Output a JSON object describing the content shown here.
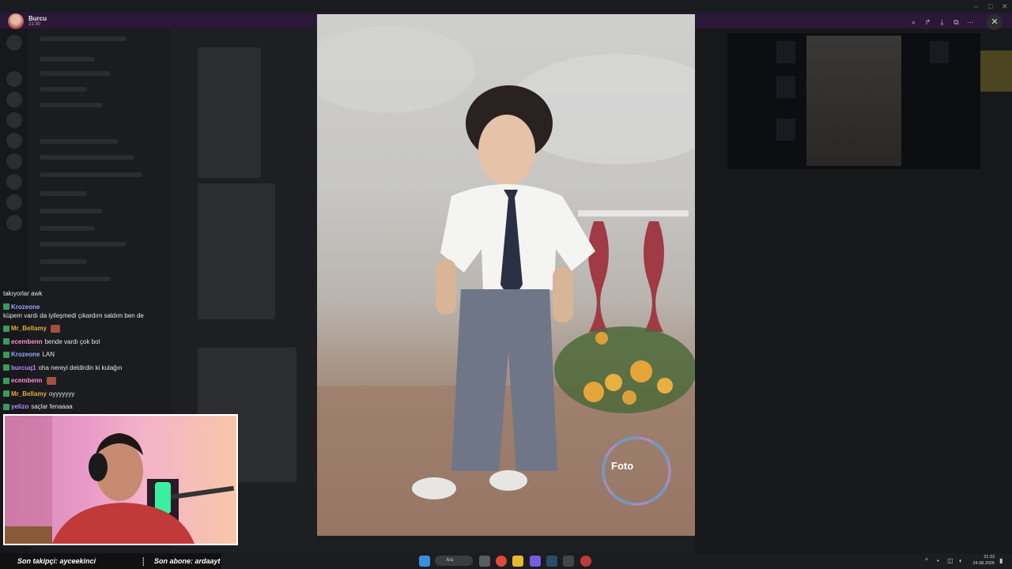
{
  "viewer": {
    "user_name": "Burcu",
    "time": "21:30",
    "tools": [
      "zoom-icon",
      "forward-icon",
      "download-icon",
      "open-external-icon",
      "more-icon"
    ],
    "close_label": "✕"
  },
  "photo": {
    "studio_logo_text": "Foto"
  },
  "chat": {
    "messages": [
      {
        "user": "",
        "text": "takıyorlar awk",
        "color": "#e6e6e6"
      },
      {
        "user": "Krozeone",
        "text": "küpem vardı da iyileşmedi çıkardım saldım ben de",
        "color": "#9aa6ff"
      },
      {
        "user": "Mr_Bellamy",
        "text": "",
        "color": "#e8a83c",
        "emote": true
      },
      {
        "user": "ecembenn",
        "text": "bende vardı çok bol",
        "color": "#ff8ad8"
      },
      {
        "user": "Krozeone",
        "text": "LAN",
        "color": "#9aa6ff"
      },
      {
        "user": "burcuq1",
        "text": "oha nereyi deldirdin ki kulağın",
        "color": "#b58cff"
      },
      {
        "user": "ecembenn",
        "text": "",
        "color": "#ff8ad8",
        "emote": true
      },
      {
        "user": "Mr_Bellamy",
        "text": "oyyyyyyy",
        "color": "#e8a83c"
      },
      {
        "user": "yelizo",
        "text": "saçlar fenaaaa",
        "color": "#b58cff"
      }
    ]
  },
  "ticker": {
    "last_follower": "Son takipçi: ayceekinci",
    "last_sub": "Son abone: ardaayt"
  },
  "taskbar": {
    "search_placeholder": "Ara",
    "clock_time": "21:33",
    "clock_date": "24.08.2026"
  }
}
